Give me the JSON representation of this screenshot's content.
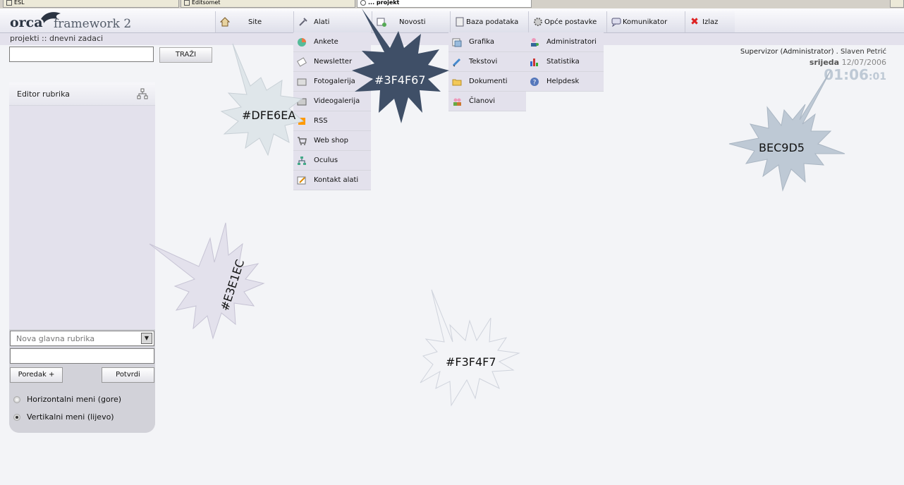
{
  "browser_tabs": [
    {
      "label": "ESL"
    },
    {
      "label": "Editsomet"
    },
    {
      "label": "... projekt"
    }
  ],
  "logo": {
    "brand": "orca",
    "product": "framework 2"
  },
  "nav": [
    {
      "label": "Site",
      "icon": "home-icon"
    },
    {
      "label": "Alati",
      "icon": "tools-icon"
    },
    {
      "label": "Novosti",
      "icon": "news-icon"
    },
    {
      "label": "Baza podataka",
      "icon": "database-icon"
    },
    {
      "label": "Opće postavke",
      "icon": "settings-icon"
    },
    {
      "label": "Komunikator",
      "icon": "chat-icon"
    },
    {
      "label": "Izlaz",
      "icon": "close-icon"
    }
  ],
  "breadcrumb": "projekti :: dnevni zadaci",
  "search": {
    "button": "TRAŽI",
    "value": ""
  },
  "user": {
    "role": "Supervizor (Administrator) .",
    "name": "Slaven Petrić",
    "day": "srijeda",
    "date": "12/07/2006",
    "time": "01:06",
    "seconds": ":01"
  },
  "menus": {
    "alati": [
      "Ankete",
      "Newsletter",
      "Fotogalerija",
      "Videogalerija",
      "RSS",
      "Web shop",
      "Oculus",
      "Kontakt alati"
    ],
    "baza": [
      "Grafika",
      "Tekstovi",
      "Dokumenti",
      "Članovi"
    ],
    "postavke": [
      "Administratori",
      "Statistika",
      "Helpdesk"
    ]
  },
  "editor": {
    "title": "Editor rubrika",
    "select_value": "Nova glavna rubrika",
    "order_button": "Poredak +",
    "confirm_button": "Potvrdi",
    "radio_horizontal": "Horizontalni meni (gore)",
    "radio_vertical": "Vertikalni meni (lijevo)",
    "selected": "vertical"
  },
  "callouts": {
    "c1": {
      "text": "#DFE6EA",
      "color": "#DFE6EA"
    },
    "c2": {
      "text": "#3F4F67",
      "color": "#3F4F67"
    },
    "c3": {
      "text": "BEC9D5",
      "color": "#BEC9D5"
    },
    "c4": {
      "text": "#E3E1EC",
      "color": "#E3E1EC"
    },
    "c5": {
      "text": "#F3F4F7",
      "color": "#F3F4F7"
    }
  }
}
